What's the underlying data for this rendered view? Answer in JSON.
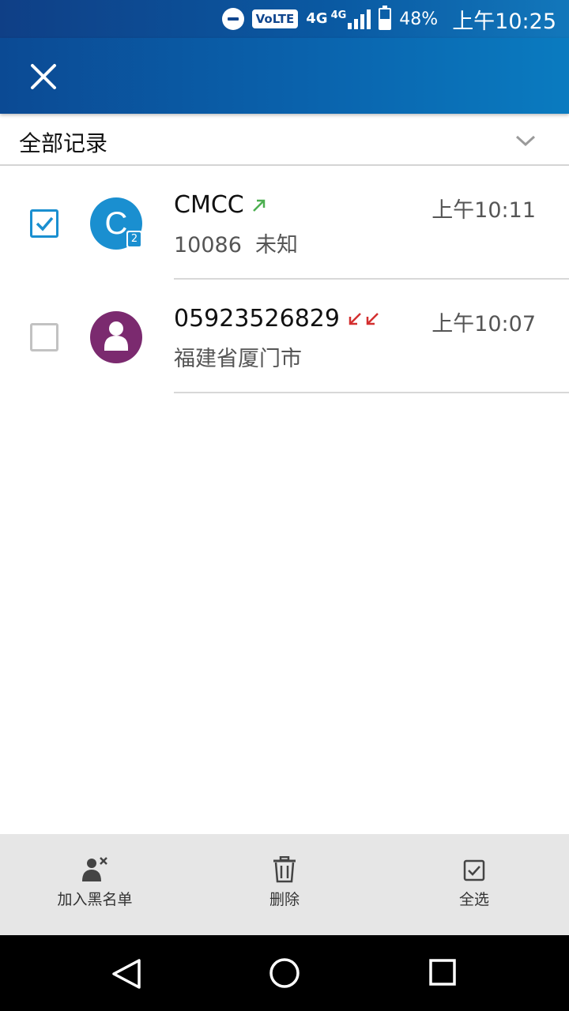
{
  "status_bar": {
    "volte": "VoLTE",
    "net1": "4G",
    "net2": "4G",
    "battery_pct": "48%",
    "battery_level": 0.48,
    "time": "上午10:25"
  },
  "header": {
    "close_icon": "close-icon"
  },
  "filter": {
    "label": "全部记录",
    "dropdown_icon": "chevron-down-icon"
  },
  "calls": [
    {
      "name": "CMCC",
      "avatar_letter": "C",
      "avatar_color": "#1a8fd0",
      "sim_badge": "2",
      "direction": "outgoing",
      "direction_color": "#4caf50",
      "time": "上午10:11",
      "detail": "10086  未知",
      "selected": true
    },
    {
      "name": "05923526829",
      "avatar_color": "#7b2a6f",
      "direction": "missed",
      "direction_color": "#d32f2f",
      "time": "上午10:07",
      "detail": "福建省厦门市",
      "selected": false
    }
  ],
  "actions": {
    "blacklist_label": "加入黑名单",
    "delete_label": "删除",
    "select_all_label": "全选"
  },
  "nav": {
    "back": "back-icon",
    "home": "home-icon",
    "recents": "recents-icon"
  }
}
